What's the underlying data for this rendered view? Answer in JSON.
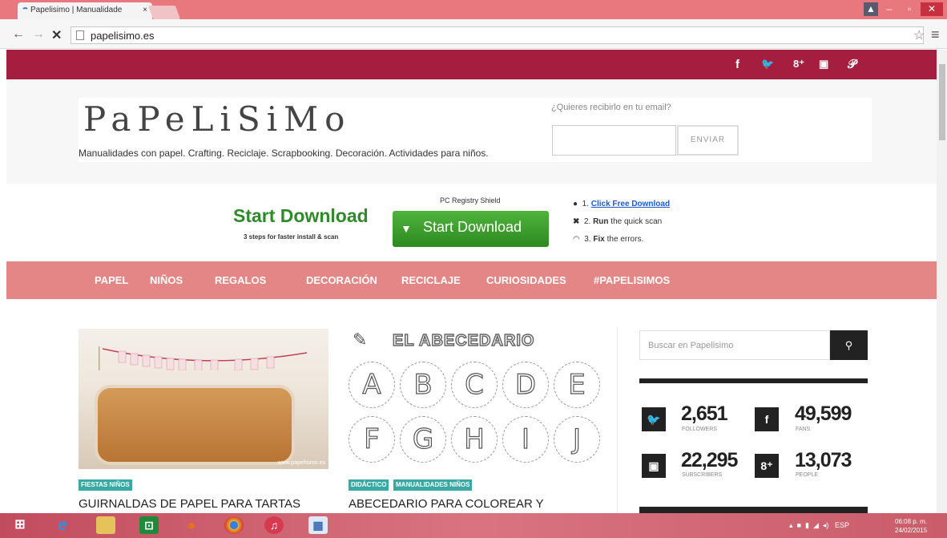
{
  "browser": {
    "tab_title": "Papelisimo | Manualidade",
    "tab_close": "×",
    "url": "papelisimo.es",
    "back": "←",
    "forward": "→",
    "stop": "✕",
    "star": "☆",
    "menu": "≡"
  },
  "topbar": {
    "social": [
      "f",
      "🐦",
      "8⁺",
      "▣",
      "𝒫"
    ],
    "social_names": [
      "facebook",
      "twitter",
      "google-plus",
      "youtube",
      "pinterest"
    ]
  },
  "header": {
    "logo": "PaPeLiSiMo",
    "tagline": "Manualidades con papel. Crafting. Reciclaje. Scrapbooking. Decoración. Actividades para niños.",
    "email_question": "¿Quieres recibirlo en tu email?",
    "email_value": "",
    "send_label": "ENVIAR"
  },
  "ad": {
    "shield": "PC Registry Shield",
    "heading": "Start Download",
    "sub": "3 steps for faster install & scan",
    "button": "Start Download",
    "steps": [
      {
        "num": "1.",
        "bold": "",
        "link": "Click Free Download",
        "rest": ""
      },
      {
        "num": "2.",
        "bold": "Run",
        "link": "",
        "rest": " the quick scan"
      },
      {
        "num": "3.",
        "bold": "Fix",
        "link": "",
        "rest": " the errors."
      }
    ]
  },
  "menu": [
    "PAPEL",
    "NIÑOS",
    "REGALOS",
    "DECORACIÓN",
    "RECICLAJE",
    "CURIOSIDADES",
    "#PAPELISIMOS"
  ],
  "posts": [
    {
      "tags": [
        "FIESTAS NIÑOS"
      ],
      "title": "GUIRNALDAS DE PAPEL PARA TARTAS",
      "watermark": "www.papelisimo.es"
    },
    {
      "tags": [
        "DIDÁCTICO",
        "MANUALIDADES NIÑOS"
      ],
      "title": "ABECEDARIO PARA COLOREAR Y",
      "image_title": "EL ABECEDARIO",
      "letters": [
        "A",
        "B",
        "C",
        "D",
        "E",
        "F",
        "G",
        "H",
        "I",
        "J"
      ]
    }
  ],
  "sidebar": {
    "search_placeholder": "Buscar en Papelisimo",
    "stats": [
      {
        "icon": "twitter-icon",
        "glyph": "🐦",
        "count": "2,651",
        "label": "FOLLOWERS"
      },
      {
        "icon": "facebook-icon",
        "glyph": "f",
        "count": "49,599",
        "label": "FANS"
      },
      {
        "icon": "youtube-icon",
        "glyph": "▣",
        "count": "22,295",
        "label": "SUBSCRIBERS"
      },
      {
        "icon": "google-plus-icon",
        "glyph": "8⁺",
        "count": "13,073",
        "label": "PEOPLE"
      }
    ]
  },
  "taskbar": {
    "lang": "ESP",
    "time": "06:08 p. m.",
    "date": "24/02/2015"
  }
}
